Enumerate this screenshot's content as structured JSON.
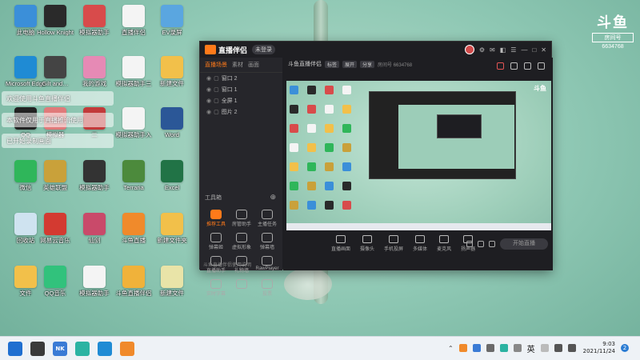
{
  "desktop": {
    "icons": [
      {
        "label": "此电脑",
        "color": "#3b8fd9",
        "icon": "computer-icon"
      },
      {
        "label": "Hollow Knight",
        "color": "#2a2a2a",
        "icon": "hollow-knight-icon"
      },
      {
        "label": "模拟器助手",
        "color": "#d84b4b",
        "icon": "app-icon"
      },
      {
        "label": "直播伴侣",
        "color": "#f4f4f4",
        "icon": "file-icon"
      },
      {
        "label": "EV录屏",
        "color": "#5aa6e0",
        "icon": "ev-recorder-icon"
      },
      {
        "label": "Microsoft Edge",
        "color": "#1f8bd4",
        "icon": "edge-icon"
      },
      {
        "label": "Gilt and…",
        "color": "#444",
        "icon": "game-icon"
      },
      {
        "label": "我的游戏",
        "color": "#e68ab5",
        "icon": "game-icon"
      },
      {
        "label": "模拟器助手三",
        "color": "#f4f4f4",
        "icon": "file-icon"
      },
      {
        "label": "新建文件",
        "color": "#f2c04a",
        "icon": "folder-icon"
      },
      {
        "label": "QQ",
        "color": "#222",
        "icon": "qq-icon"
      },
      {
        "label": "模拟器",
        "color": "#e07a7a",
        "icon": "game-icon"
      },
      {
        "label": "二",
        "color": "#c23a3a",
        "icon": "app-icon"
      },
      {
        "label": "模拟器助手入",
        "color": "#f4f4f4",
        "icon": "file-icon"
      },
      {
        "label": "Word",
        "color": "#2b5797",
        "icon": "word-icon"
      },
      {
        "label": "微信",
        "color": "#2fb65a",
        "icon": "wechat-icon"
      },
      {
        "label": "英雄联盟",
        "color": "#c9a13a",
        "icon": "lol-icon"
      },
      {
        "label": "模拟器助手",
        "color": "#333",
        "icon": "app-icon"
      },
      {
        "label": "Terraria",
        "color": "#4c8a3c",
        "icon": "terraria-icon"
      },
      {
        "label": "Excel",
        "color": "#217346",
        "icon": "excel-icon"
      },
      {
        "label": "回收站",
        "color": "#cfe3f0",
        "icon": "recycle-bin-icon"
      },
      {
        "label": "网易云音乐",
        "color": "#d33a31",
        "icon": "netease-music-icon"
      },
      {
        "label": "仙剑",
        "color": "#c94a6a",
        "icon": "game-icon"
      },
      {
        "label": "斗鱼直播",
        "color": "#f08a2b",
        "icon": "douyu-icon"
      },
      {
        "label": "新建文件夹",
        "color": "#f2c04a",
        "icon": "folder-icon"
      },
      {
        "label": "文件",
        "color": "#f2c04a",
        "icon": "folder-icon"
      },
      {
        "label": "QQ音乐",
        "color": "#31c27c",
        "icon": "qq-music-icon"
      },
      {
        "label": "模拟器助手",
        "color": "#f4f4f4",
        "icon": "file-icon"
      },
      {
        "label": "斗鱼直播伴侣",
        "color": "#f0b23a",
        "icon": "douyu-icon"
      },
      {
        "label": "新建文件",
        "color": "#e9e4a8",
        "icon": "file-icon"
      }
    ],
    "toasts": [
      "欢迎使用斗鱼直播伴侣",
      "本软件仅用于直播推流使用",
      "已开始录制画面"
    ]
  },
  "watermark": {
    "mark": "斗鱼",
    "sub": "房间号",
    "id": "6634768"
  },
  "app": {
    "title": "直播伴侣",
    "vip": "未登录",
    "sidebar": {
      "tabs": [
        "直播场景",
        "素材",
        "画面"
      ],
      "scenes": [
        "窗口 2",
        "窗口 1",
        "全屏 1",
        "图片 2"
      ],
      "tools_heading": "工具箱",
      "tools": [
        "推荐工具",
        "房管助手",
        "主播任务",
        "弹幕姬",
        "虚拟形象",
        "弹幕墙",
        "直播助手",
        "礼物墙",
        "RawPlayer",
        "实时字幕",
        "",
        "投票"
      ],
      "footer": "斗鱼直播伴侣使用说明"
    },
    "main": {
      "stream_title": "斗鱼直播伴侣",
      "chips": [
        "标签",
        "展开",
        "分享"
      ],
      "meta": "房间号 6634768",
      "controls": [
        "直播画面",
        "摄像头",
        "手机投屏",
        "多媒体",
        "麦克风",
        "扬声器"
      ],
      "start_label": "开始直播"
    }
  },
  "taskbar": {
    "pins": [
      {
        "label": "",
        "color": "#1f6fd0",
        "icon": "windows-start-icon"
      },
      {
        "label": "",
        "color": "#3a3a3a",
        "icon": "file-explorer-icon"
      },
      {
        "label": "NK",
        "color": "#3a7bd5",
        "icon": "app-icon"
      },
      {
        "label": "",
        "color": "#2bb3a2",
        "icon": "app-icon"
      },
      {
        "label": "",
        "color": "#1f8bd4",
        "icon": "edge-icon"
      },
      {
        "label": "",
        "color": "#f08a2b",
        "icon": "douyu-icon"
      }
    ],
    "language": "英",
    "time": "9:03",
    "date": "2021/11/24",
    "notifications": "2"
  }
}
